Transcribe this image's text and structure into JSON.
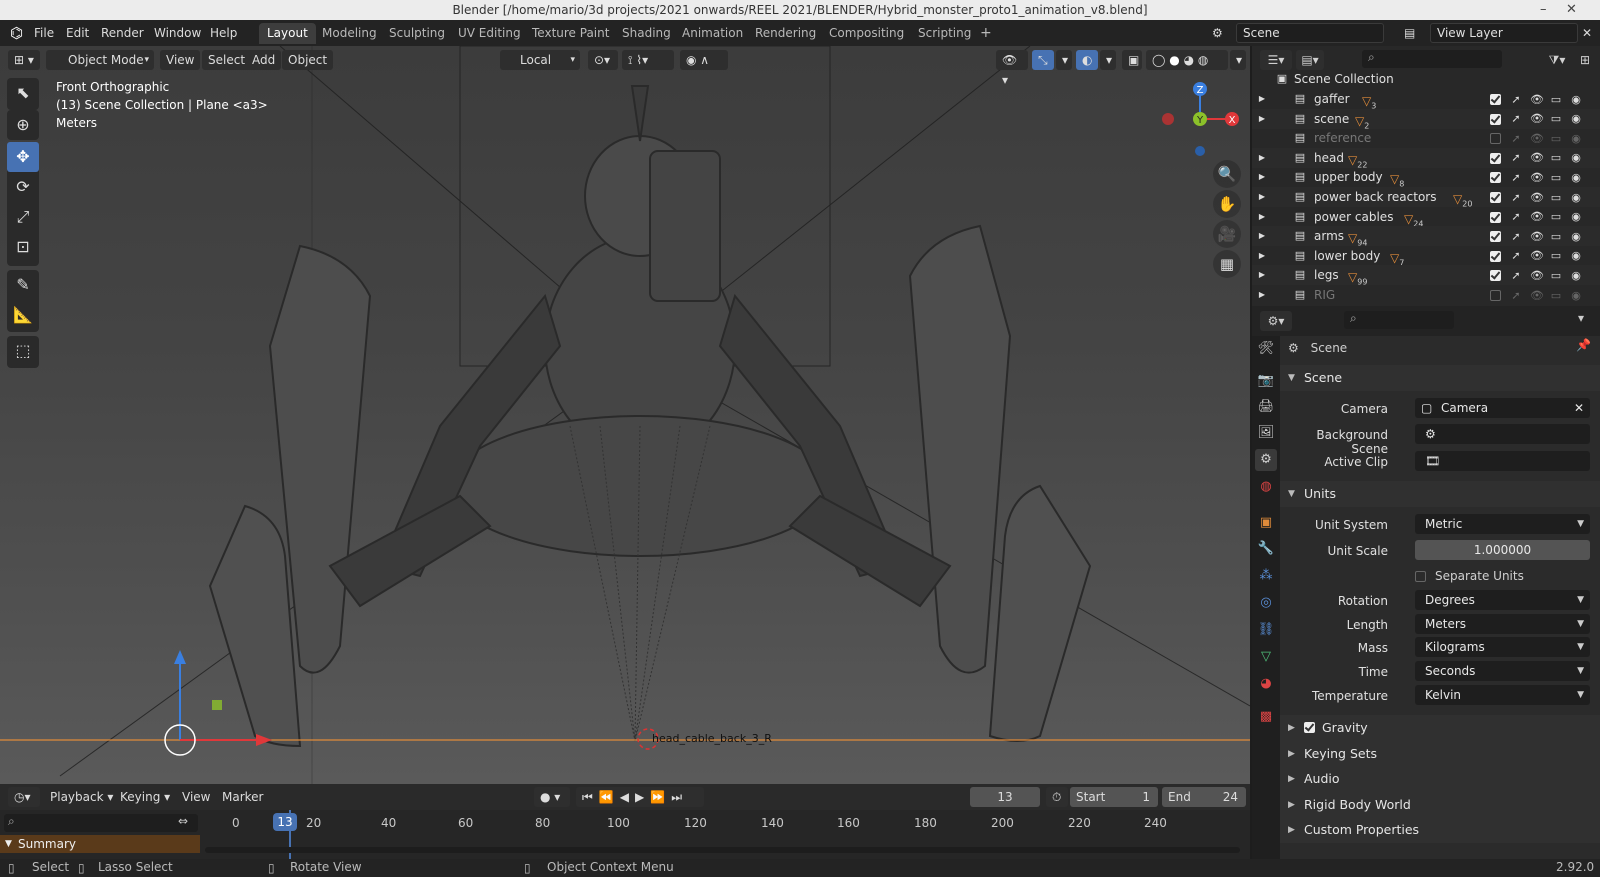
{
  "window": {
    "title": "Blender [/home/mario/3d projects/2021 onwards/REEL 2021/BLENDER/Hybrid_monster_proto1_animation_v8.blend]",
    "minimize": "–",
    "close": "✕"
  },
  "menu": [
    "File",
    "Edit",
    "Render",
    "Window",
    "Help"
  ],
  "workspaces": [
    "Layout",
    "Modeling",
    "Sculpting",
    "UV Editing",
    "Texture Paint",
    "Shading",
    "Animation",
    "Rendering",
    "Compositing",
    "Scripting"
  ],
  "add_workspace": "+",
  "scene_field": "Scene",
  "view_layer_field": "View Layer",
  "viewport": {
    "mode": "Object Mode",
    "menus": [
      "View",
      "Select",
      "Add",
      "Object"
    ],
    "transform_orientation": "Local",
    "info": [
      "Front Orthographic",
      "(13) Scene Collection | Plane <a3>",
      "Meters"
    ],
    "label_overlay": "head_cable_back_3_R",
    "axes": {
      "z": "Z",
      "y": "Y",
      "x": "X"
    }
  },
  "timeline": {
    "menus": [
      "Playback",
      "Keying",
      "View",
      "Marker"
    ],
    "current_frame": "13",
    "start_label": "Start",
    "start": "1",
    "end_label": "End",
    "end": "24",
    "ticks": [
      "0",
      "20",
      "40",
      "60",
      "80",
      "100",
      "120",
      "140",
      "160",
      "180",
      "200",
      "220",
      "240"
    ],
    "playhead": "13",
    "summary": "Summary"
  },
  "outliner": {
    "root": "Scene Collection",
    "collections": [
      {
        "name": "gaffer",
        "badge": "3",
        "enabled": true
      },
      {
        "name": "scene",
        "badge": "2",
        "enabled": true
      },
      {
        "name": "reference",
        "badge": "",
        "enabled": false
      },
      {
        "name": "head",
        "badge": "22",
        "enabled": true
      },
      {
        "name": "upper body",
        "badge": "8",
        "enabled": true
      },
      {
        "name": "power back reactors",
        "badge": "20",
        "enabled": true
      },
      {
        "name": "power cables",
        "badge": "24",
        "enabled": true
      },
      {
        "name": "arms",
        "badge": "94",
        "enabled": true
      },
      {
        "name": "lower body",
        "badge": "7",
        "enabled": true
      },
      {
        "name": "legs",
        "badge": "99",
        "enabled": true
      },
      {
        "name": "RIG",
        "badge": "",
        "enabled": false
      }
    ]
  },
  "properties": {
    "context": "Scene",
    "scene_section": "Scene",
    "camera_label": "Camera",
    "camera_value": "Camera",
    "background_scene_label": "Background Scene",
    "active_clip_label": "Active Clip",
    "units_section": "Units",
    "unit_system_label": "Unit System",
    "unit_system": "Metric",
    "unit_scale_label": "Unit Scale",
    "unit_scale": "1.000000",
    "separate_units": "Separate Units",
    "rotation_label": "Rotation",
    "rotation": "Degrees",
    "length_label": "Length",
    "length": "Meters",
    "mass_label": "Mass",
    "mass": "Kilograms",
    "time_label": "Time",
    "time": "Seconds",
    "temperature_label": "Temperature",
    "temperature": "Kelvin",
    "gravity": "Gravity",
    "sections": [
      "Keying Sets",
      "Audio",
      "Rigid Body World",
      "Custom Properties"
    ]
  },
  "status": {
    "select": "Select",
    "lasso": "Lasso Select",
    "rotate": "Rotate View",
    "context_menu": "Object Context Menu",
    "version": "2.92.0"
  },
  "colors": {
    "accent": "#4772b3",
    "orange": "#e08b3a",
    "x_axis": "#e0383a",
    "y_axis": "#8cc12a",
    "z_axis": "#3a7fe0"
  }
}
